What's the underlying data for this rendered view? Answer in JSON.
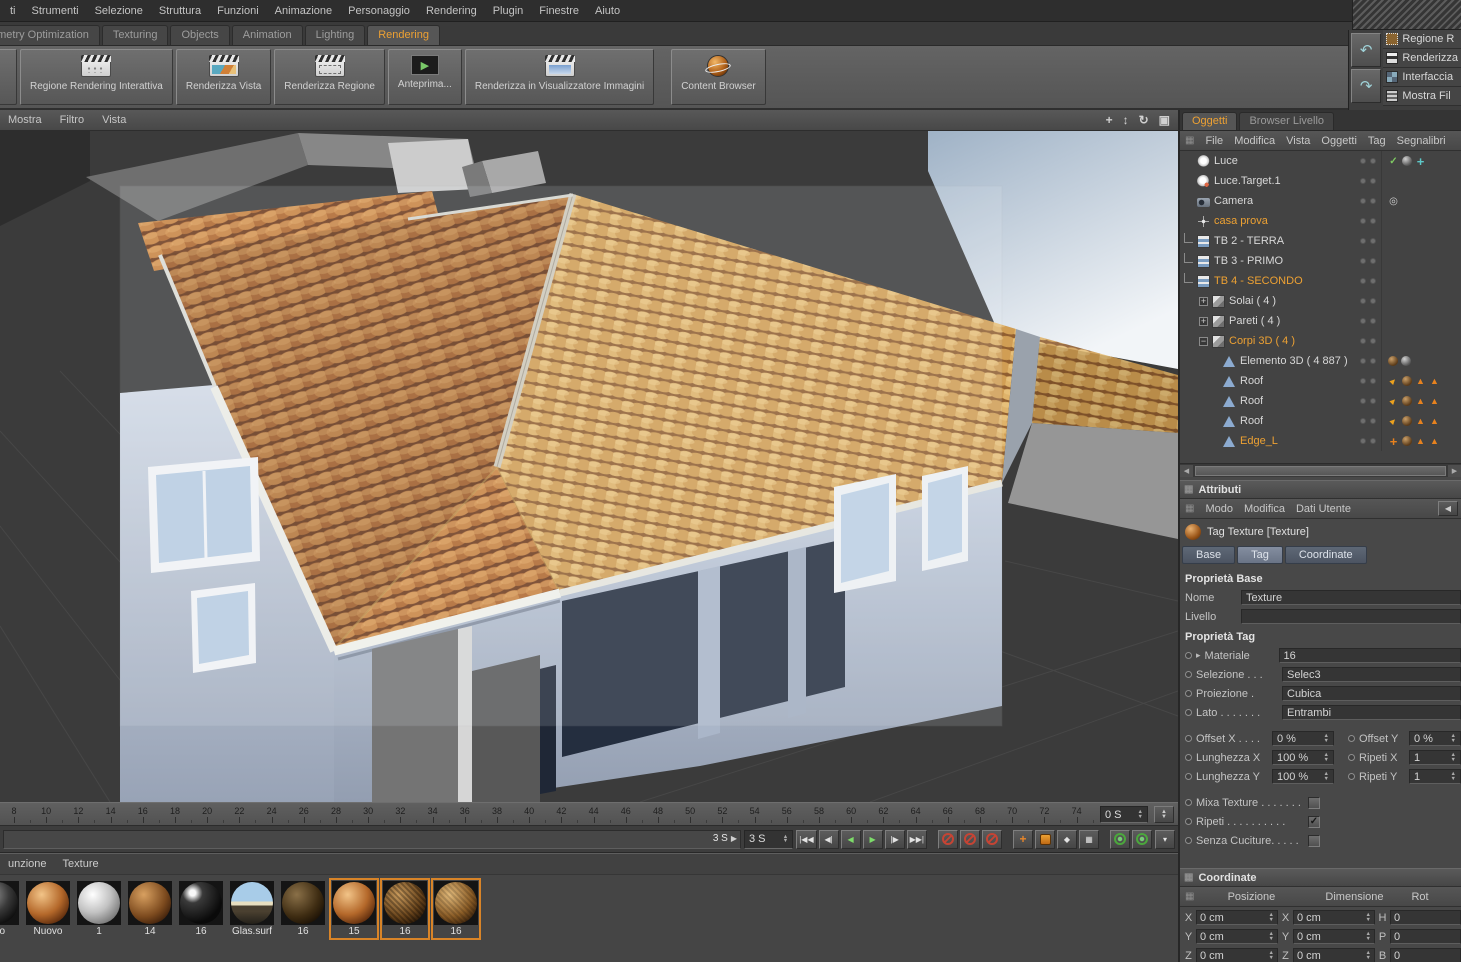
{
  "colors": {
    "accent": "#eda133",
    "selection": "#d88428"
  },
  "menubar": {
    "items": [
      "ti",
      "Strumenti",
      "Selezione",
      "Struttura",
      "Funzioni",
      "Animazione",
      "Personaggio",
      "Rendering",
      "Plugin",
      "Finestre",
      "Aiuto"
    ]
  },
  "layout_tabs": {
    "items": [
      {
        "label": "ometry Optimization",
        "active": false
      },
      {
        "label": "Texturing",
        "active": false
      },
      {
        "label": "Objects",
        "active": false
      },
      {
        "label": "Animation",
        "active": false
      },
      {
        "label": "Lighting",
        "active": false
      },
      {
        "label": "Rendering",
        "active": true
      }
    ]
  },
  "toolbar": {
    "buttons": [
      {
        "label": "Regione Rendering Interattiva",
        "icon": "interactive-render-region-icon",
        "icon_class": "ic-clap ic-irr"
      },
      {
        "label": "Renderizza Vista",
        "icon": "render-view-icon",
        "icon_class": "ic-clap ic-rv"
      },
      {
        "label": "Renderizza Regione",
        "icon": "render-region-icon",
        "icon_class": "ic-clap ic-rr"
      },
      {
        "label": "Anteprima...",
        "icon": "preview-icon",
        "icon_class": "ic-prev"
      },
      {
        "label": "Renderizza in Visualizzatore Immagini",
        "icon": "render-picture-viewer-icon",
        "icon_class": "ic-clap ic-rpv"
      },
      {
        "label": "Content Browser",
        "icon": "content-browser-icon",
        "icon_class": "ic-cb",
        "gap_before": true
      }
    ]
  },
  "quick_panel": {
    "items": [
      "Regione R",
      "Renderizza",
      "Interfaccia",
      "Mostra Fil"
    ]
  },
  "viewport": {
    "menu": [
      "Mostra",
      "Filtro",
      "Vista"
    ],
    "nav_icons": [
      {
        "name": "pan-icon",
        "glyph": "+"
      },
      {
        "name": "dolly-icon",
        "glyph": "↕"
      },
      {
        "name": "rotate-icon",
        "glyph": "↻"
      },
      {
        "name": "toggle-view-icon",
        "glyph": "▣"
      }
    ]
  },
  "object_manager": {
    "tabs": [
      {
        "label": "Oggetti",
        "active": true
      },
      {
        "label": "Browser Livello",
        "active": false
      }
    ],
    "menu": [
      "File",
      "Modifica",
      "Vista",
      "Oggetti",
      "Tag",
      "Segnalibri"
    ],
    "items": [
      {
        "label": "Luce",
        "selected": false,
        "indent": 0,
        "expander": "",
        "icon": "light-icon",
        "badges": [
          "check",
          "ball",
          "cross"
        ]
      },
      {
        "label": "Luce.Target.1",
        "selected": false,
        "indent": 0,
        "expander": "",
        "icon": "light-target-icon",
        "badges": []
      },
      {
        "label": "Camera",
        "selected": false,
        "indent": 0,
        "expander": "",
        "icon": "camera-icon",
        "badges": [
          "target"
        ]
      },
      {
        "label": "casa prova",
        "selected": true,
        "indent": 0,
        "expander": "",
        "icon": "null-icon",
        "badges": []
      },
      {
        "label": "TB 2 - TERRA",
        "selected": false,
        "indent": 0,
        "expander": "|",
        "icon": "floor-icon",
        "badges": []
      },
      {
        "label": "TB 3 - PRIMO",
        "selected": false,
        "indent": 0,
        "expander": "|",
        "icon": "floor-icon",
        "badges": []
      },
      {
        "label": "TB 4 - SECONDO",
        "selected": true,
        "indent": 0,
        "expander": "|",
        "icon": "floor-icon",
        "badges": []
      },
      {
        "label": "Solai ( 4 )",
        "selected": false,
        "indent": 1,
        "expander": "+",
        "icon": "group-icon",
        "badges": []
      },
      {
        "label": "Pareti ( 4 )",
        "selected": false,
        "indent": 1,
        "expander": "+",
        "icon": "group-icon",
        "badges": []
      },
      {
        "label": "Corpi 3D ( 4 )",
        "selected": true,
        "indent": 1,
        "expander": "-",
        "icon": "group-icon",
        "badges": []
      },
      {
        "label": "Elemento 3D ( 4 887 )",
        "selected": false,
        "indent": 2,
        "expander": "",
        "icon": "poly-icon",
        "badges": [
          "ballb",
          "ball"
        ]
      },
      {
        "label": "Roof",
        "selected": false,
        "indent": 2,
        "expander": "",
        "icon": "poly-icon",
        "badges": [
          "cone",
          "ballb",
          "tri",
          "tri"
        ]
      },
      {
        "label": "Roof",
        "selected": false,
        "indent": 2,
        "expander": "",
        "icon": "poly-icon",
        "badges": [
          "cone",
          "ballb",
          "tri",
          "tri"
        ]
      },
      {
        "label": "Roof",
        "selected": false,
        "indent": 2,
        "expander": "",
        "icon": "poly-icon",
        "badges": [
          "cone",
          "ballb",
          "tri",
          "tri"
        ]
      },
      {
        "label": "Edge_L",
        "selected": true,
        "indent": 2,
        "expander": "",
        "icon": "poly-icon",
        "badges": [
          "oplus",
          "ballb",
          "tri",
          "tri"
        ]
      }
    ]
  },
  "attributes": {
    "title": "Attributi",
    "menu": [
      "Modo",
      "Modifica",
      "Dati Utente"
    ],
    "object_title": "Tag Texture [Texture]",
    "tabs": [
      {
        "label": "Base",
        "active": false
      },
      {
        "label": "Tag",
        "active": true
      },
      {
        "label": "Coordinate",
        "active": false
      }
    ],
    "base_section": {
      "title": "Proprietà Base",
      "rows": [
        {
          "label": "Nome",
          "value": "Texture"
        },
        {
          "label": "Livello",
          "value": ""
        }
      ]
    },
    "tag_section": {
      "title": "Proprietà Tag",
      "rows": [
        {
          "label": "Materiale",
          "value": "16",
          "arrow": true
        },
        {
          "label": "Selezione . . .",
          "value": "Selec3"
        },
        {
          "label": "Proiezione .",
          "value": "Cubica"
        },
        {
          "label": "Lato . . . . . . .",
          "value": "Entrambi"
        }
      ],
      "pairs": [
        {
          "l1": "Offset X . . . .",
          "v1": "0 %",
          "l2": "Offset Y",
          "v2": "0 %"
        },
        {
          "l1": "Lunghezza X",
          "v1": "100 %",
          "l2": "Ripeti X",
          "v2": "1"
        },
        {
          "l1": "Lunghezza Y",
          "v1": "100 %",
          "l2": "Ripeti Y",
          "v2": "1"
        }
      ],
      "checks": [
        {
          "label": "Mixa Texture . . . . . . .",
          "checked": false
        },
        {
          "label": "Ripeti . . . . . . . . . .",
          "checked": true
        },
        {
          "label": "Senza Cuciture. . . . .",
          "checked": false
        }
      ]
    }
  },
  "coords_panel": {
    "title": "Coordinate",
    "menu": [
      "Posizione",
      "Dimensione",
      "Rot"
    ],
    "rows": [
      {
        "a": "X",
        "av": "0 cm",
        "b": "X",
        "bv": "0 cm",
        "c": "H",
        "cv": "0"
      },
      {
        "a": "Y",
        "av": "0 cm",
        "b": "Y",
        "bv": "0 cm",
        "c": "P",
        "cv": "0"
      },
      {
        "a": "Z",
        "av": "0 cm",
        "b": "Z",
        "bv": "0 cm",
        "c": "B",
        "cv": "0"
      }
    ]
  },
  "timeline": {
    "ticks": [
      "8",
      "10",
      "12",
      "14",
      "16",
      "18",
      "20",
      "22",
      "24",
      "26",
      "28",
      "30",
      "32",
      "34",
      "36",
      "38",
      "40",
      "42",
      "44",
      "46",
      "48",
      "50",
      "52",
      "54",
      "56",
      "58",
      "60",
      "62",
      "64",
      "66",
      "68",
      "70",
      "72",
      "74"
    ],
    "end_label": "0 S",
    "marker_label": "3 S",
    "time_field": "3 S"
  },
  "transport": {
    "buttons": [
      {
        "name": "goto-start-button",
        "glyph": "|◀◀"
      },
      {
        "name": "previous-key-button",
        "glyph": "◀|"
      },
      {
        "name": "play-backward-button",
        "glyph": "◀",
        "cls": "green"
      },
      {
        "name": "play-forward-button",
        "glyph": "▶",
        "cls": "green"
      },
      {
        "name": "next-key-button",
        "glyph": "|▶"
      },
      {
        "name": "goto-end-button",
        "glyph": "▶▶|"
      }
    ],
    "record_buttons": [
      {
        "name": "record-position-button"
      },
      {
        "name": "record-scale-button"
      },
      {
        "name": "record-rotation-button"
      }
    ],
    "key_buttons": [
      {
        "name": "autokey-button",
        "glyph": "+",
        "cls": "orange"
      },
      {
        "name": "keyframe-selection-button",
        "glyph": "",
        "cls": "orangesq"
      },
      {
        "name": "keyframe-button",
        "glyph": "◆"
      },
      {
        "name": "options-grid-button",
        "glyph": "▦"
      }
    ],
    "solo_buttons": [
      {
        "name": "solo-green-a-button"
      },
      {
        "name": "solo-green-b-button"
      }
    ],
    "more_button_glyph": "▾"
  },
  "materials": {
    "menu": [
      "unzione",
      "Texture"
    ],
    "items": [
      {
        "label": "ovo",
        "kind": "sph-dark",
        "selected": false
      },
      {
        "label": "Nuovo",
        "kind": "sph-copper",
        "selected": false
      },
      {
        "label": "1",
        "kind": "sph-light",
        "selected": false
      },
      {
        "label": "14",
        "kind": "sph-brown",
        "selected": false
      },
      {
        "label": "16",
        "kind": "sph-black",
        "selected": false
      },
      {
        "label": "Glas.surf",
        "kind": "sph-sky",
        "selected": false
      },
      {
        "label": "16",
        "kind": "sph-darkbrown",
        "selected": false
      },
      {
        "label": "15",
        "kind": "sph-copper",
        "selected": true
      },
      {
        "label": "16",
        "kind": "sph-bumpdark",
        "selected": true
      },
      {
        "label": "16",
        "kind": "sph-bumptan",
        "selected": true
      }
    ]
  }
}
